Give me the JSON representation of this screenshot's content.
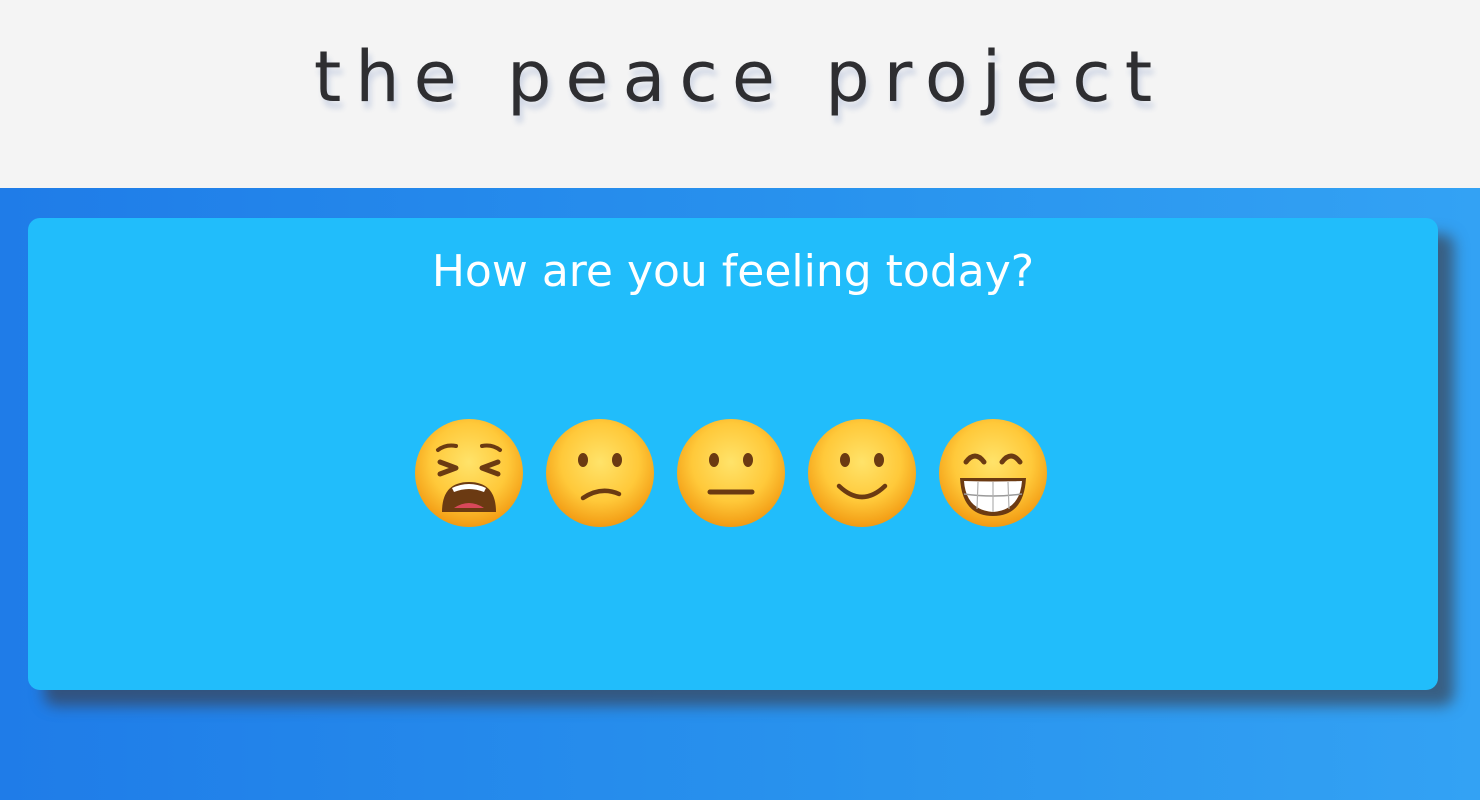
{
  "header": {
    "title": "the peace project"
  },
  "mood_prompt": {
    "question": "How are you feeling today?",
    "options": [
      {
        "icon": "weary-face-icon",
        "glyph": "😩"
      },
      {
        "icon": "confused-face-icon",
        "glyph": "😕"
      },
      {
        "icon": "neutral-face-icon",
        "glyph": "😐"
      },
      {
        "icon": "slightly-smiling-face-icon",
        "glyph": "🙂"
      },
      {
        "icon": "grinning-face-icon",
        "glyph": "😁"
      }
    ]
  },
  "colors": {
    "header_bg": "#f4f4f4",
    "title_text": "#2e2e31",
    "page_gradient_start": "#1f7ce8",
    "page_gradient_end": "#33a2f4",
    "card_bg": "#21bdfb",
    "question_text": "#ffffff",
    "emoji_face": "#ffc93a",
    "emoji_features": "#6b3a12"
  }
}
